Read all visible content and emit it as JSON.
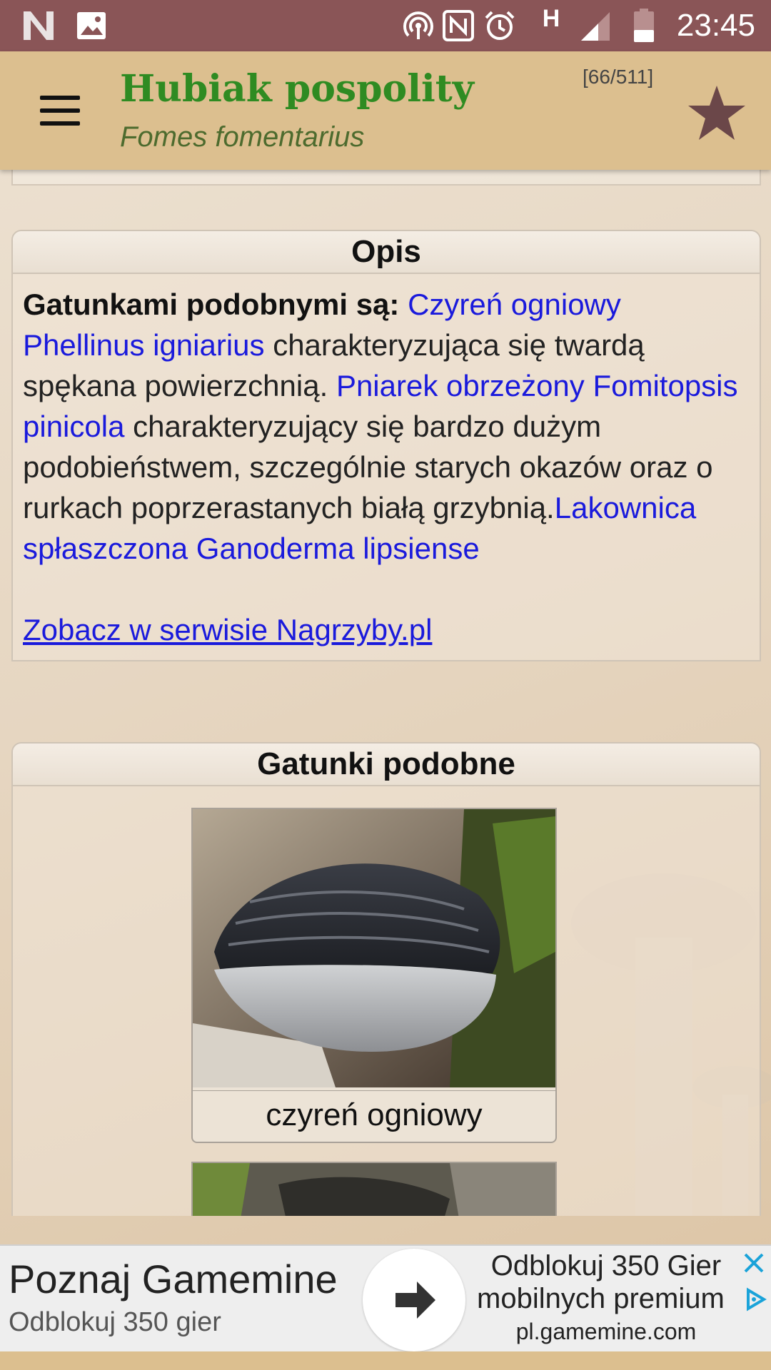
{
  "status_bar": {
    "time": "23:45",
    "network_type": "H",
    "icons": [
      "n-logo-icon",
      "image-icon",
      "hotspot-icon",
      "nfc-icon",
      "alarm-icon",
      "signal-icon",
      "battery-icon"
    ]
  },
  "app_bar": {
    "title": "Hubiak pospolity",
    "subtitle": "Fomes fomentarius",
    "counter": "[66/511]",
    "icons": [
      "menu-icon",
      "star-icon"
    ],
    "colors": {
      "title": "#2f8b22",
      "bar": "#dcbf8f",
      "status_bar": "#8a5557"
    }
  },
  "description": {
    "header": "Opis",
    "lead": "Gatunkami podobnymi są:",
    "link1": "Czyreń ogniowy Phellinus igniarius",
    "text1": " charakteryzująca się twardą spękana powierzchnią. ",
    "link2": "Pniarek obrzeżony Fomitopsis pinicola",
    "text2": " charakteryzujący się bardzo dużym podobieństwem, szczególnie starych okazów oraz o rurkach poprzerastanych białą grzybnią.",
    "link3": "Lakownica spłaszczona Ganoderma lipsiense",
    "external_link": "Zobacz w serwisie Nagrzyby.pl"
  },
  "similar_species": {
    "header": "Gatunki podobne",
    "items": [
      {
        "caption": "czyreń ogniowy"
      }
    ]
  },
  "ad": {
    "title": "Poznaj Gamemine",
    "subtitle": "Odblokuj 350 gier",
    "right_line1": "Odblokuj 350 Gier",
    "right_line2": "mobilnych premium",
    "right_line3": "pl.gamemine.com"
  }
}
